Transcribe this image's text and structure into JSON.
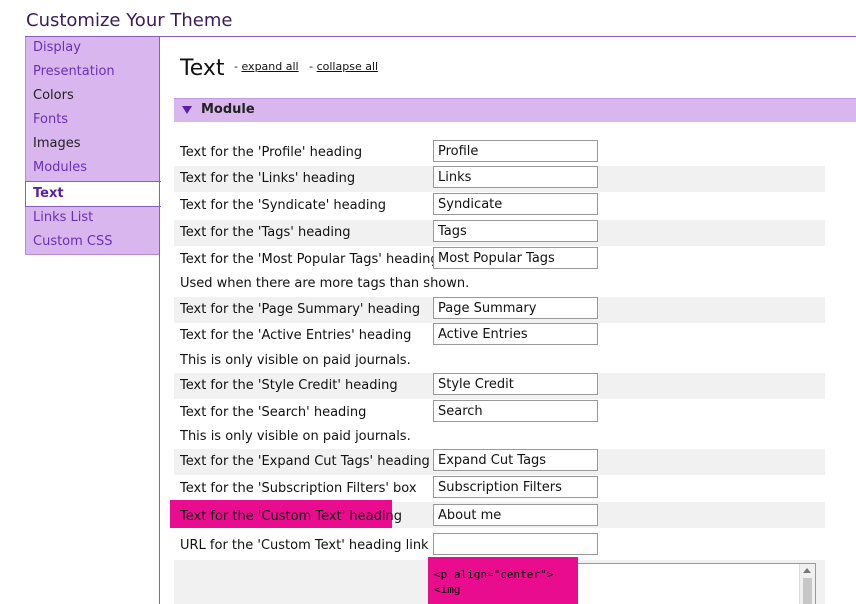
{
  "page_title": "Customize Your Theme",
  "sidebar": {
    "items": [
      {
        "label": "Display"
      },
      {
        "label": "Presentation"
      },
      {
        "label": "Colors"
      },
      {
        "label": "Fonts"
      },
      {
        "label": "Images"
      },
      {
        "label": "Modules"
      },
      {
        "label": "Text",
        "active": true
      },
      {
        "label": "Links List"
      },
      {
        "label": "Custom CSS"
      }
    ]
  },
  "main": {
    "heading": "Text",
    "expand_all": "expand all",
    "collapse_all": "collapse all",
    "separator": "-",
    "section": {
      "title": "Module",
      "expanded": true
    },
    "rows": [
      {
        "label": "Text for the 'Profile' heading",
        "value": "Profile"
      },
      {
        "label": "Text for the 'Links' heading",
        "value": "Links"
      },
      {
        "label": "Text for the 'Syndicate' heading",
        "value": "Syndicate"
      },
      {
        "label": "Text for the 'Tags' heading",
        "value": "Tags"
      },
      {
        "label": "Text for the 'Most Popular Tags' heading",
        "value": "Most Popular Tags"
      },
      {
        "label": "Text for the 'Page Summary' heading",
        "value": "Page Summary"
      },
      {
        "label": "Text for the 'Active Entries' heading",
        "value": "Active Entries"
      },
      {
        "label": "Text for the 'Style Credit' heading",
        "value": "Style Credit"
      },
      {
        "label": "Text for the 'Search' heading",
        "value": "Search"
      },
      {
        "label": "Text for the 'Expand Cut Tags' heading",
        "value": "Expand Cut Tags"
      },
      {
        "label": "Text for the 'Subscription Filters' box",
        "value": "Subscription Filters"
      },
      {
        "label": "Text for the 'Custom Text' heading",
        "value": "About me"
      },
      {
        "label": "URL for the 'Custom Text' heading link",
        "value": ""
      }
    ],
    "notes": {
      "most_popular": "Used when there are more tags than shown.",
      "active_entries": "This is only visible on paid journals.",
      "search": "This is only visible on paid journals."
    },
    "custom_text_code": {
      "line1": "<p align=\"center\">",
      "line2": "<img"
    }
  },
  "colors": {
    "accent": "#d9b6ee",
    "link": "#6b2fb8",
    "highlight": "#ea0c8e"
  }
}
